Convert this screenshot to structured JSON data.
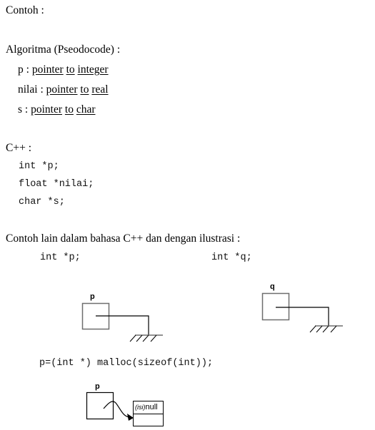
{
  "heading": "Contoh :",
  "pseudocode": {
    "title": "Algoritma (Pseodocode) :",
    "lines": [
      {
        "var": "p",
        "sep": " : ",
        "w1": "pointer",
        "w2": "to",
        "w3": "integer"
      },
      {
        "var": "nilai",
        "sep": " : ",
        "w1": "pointer",
        "w2": "to",
        "w3": "real"
      },
      {
        "var": "s",
        "sep": " : ",
        "w1": "pointer",
        "w2": "to",
        "w3": "char"
      }
    ]
  },
  "cpp": {
    "title": "C++ :",
    "lines": [
      "int *p;",
      "float *nilai;",
      "char *s;"
    ]
  },
  "illustration": {
    "title": "Contoh lain dalam bahasa C++ dan dengan ilustrasi :",
    "code_left": "int *p;",
    "code_right": "int *q;",
    "label_p": "p",
    "label_q": "q",
    "malloc_code": "p=(int *) malloc(sizeof(int));",
    "label_p2": "p",
    "node_prefix": "(isi)",
    "node_value": "null"
  }
}
